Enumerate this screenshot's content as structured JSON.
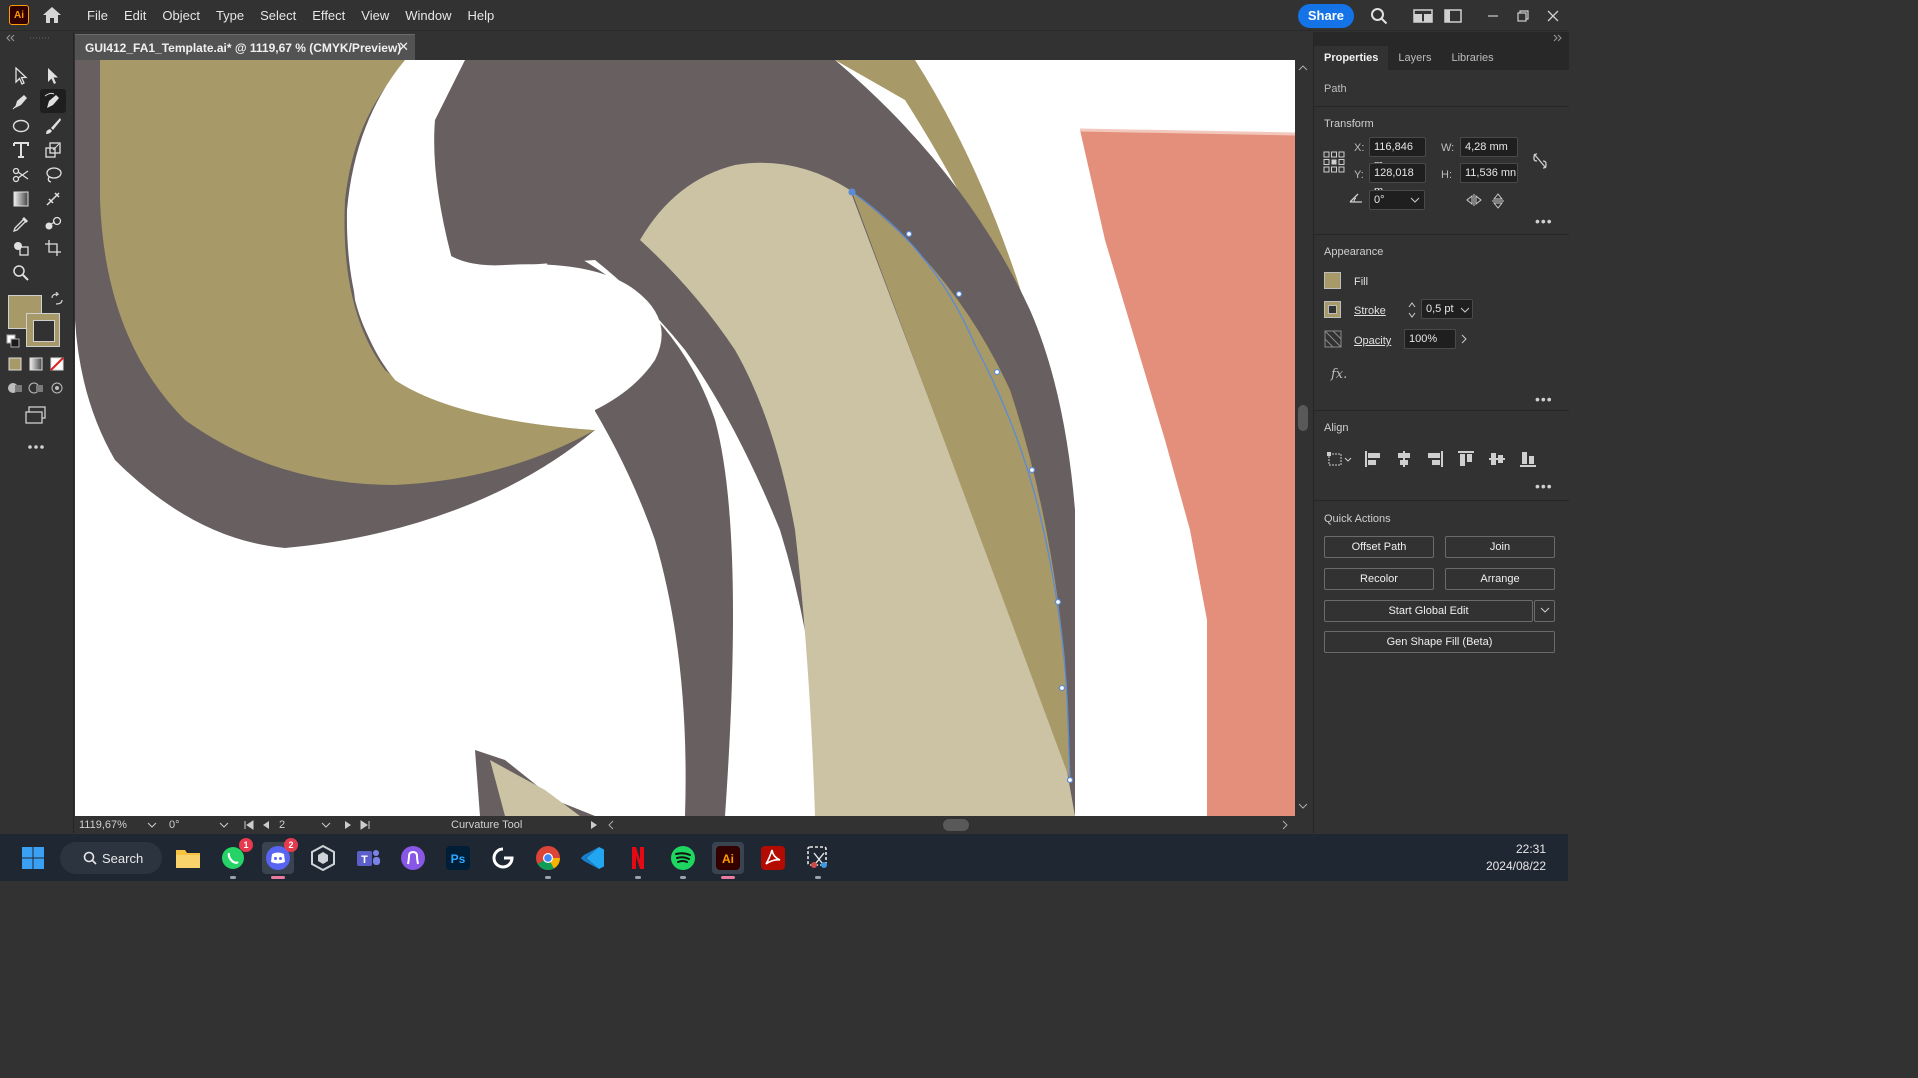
{
  "app": {
    "logo_text": "Ai",
    "menus": [
      "File",
      "Edit",
      "Object",
      "Type",
      "Select",
      "Effect",
      "View",
      "Window",
      "Help"
    ],
    "share_label": "Share"
  },
  "document": {
    "tab_title": "GUI412_FA1_Template.ai* @ 1119,67 % (CMYK/Preview)",
    "close_glyph": "✕"
  },
  "statusbar": {
    "zoom": "1119,67%",
    "rotation": "0°",
    "artboard": "2",
    "tool_name": "Curvature Tool"
  },
  "panel": {
    "tabs": [
      "Properties",
      "Layers",
      "Libraries"
    ],
    "object_type": "Path",
    "transform": {
      "title": "Transform",
      "x_label": "X:",
      "x_value": "116,846 m",
      "y_label": "Y:",
      "y_value": "128,018 m",
      "w_label": "W:",
      "w_value": "4,28 mm",
      "h_label": "H:",
      "h_value": "11,536 mn",
      "angle_value": "0°"
    },
    "appearance": {
      "title": "Appearance",
      "fill_label": "Fill",
      "stroke_label": "Stroke",
      "stroke_value": "0,5 pt",
      "opacity_label": "Opacity",
      "opacity_value": "100%",
      "fx_label": "fx."
    },
    "align": {
      "title": "Align"
    },
    "quick_actions": {
      "title": "Quick Actions",
      "offset_path": "Offset Path",
      "join": "Join",
      "recolor": "Recolor",
      "arrange": "Arrange",
      "start_global_edit": "Start Global Edit",
      "gen_shape_fill": "Gen Shape Fill (Beta)"
    }
  },
  "taskbar": {
    "search_label": "Search",
    "time": "22:31",
    "date": "2024/08/22",
    "whatsapp_badge": "1",
    "discord_badge": "2",
    "photoshop_label": "Ps",
    "illustrator_label": "Ai"
  },
  "colors": {
    "fill_swatch": "#a89968",
    "canvas_gray": "#675f60",
    "canvas_khaki": "#a89968",
    "canvas_beige": "#ccc3a4",
    "canvas_salmon": "#e48f7c",
    "path_selection": "#5b8bd6",
    "share_blue": "#1473e6"
  }
}
